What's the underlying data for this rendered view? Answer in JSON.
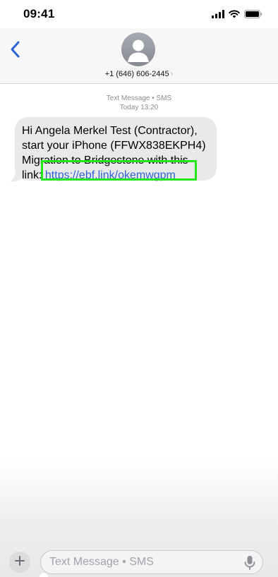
{
  "status_bar": {
    "time": "09:41"
  },
  "header": {
    "contact": "+1 (646) 606-2445",
    "chevron": "›"
  },
  "conversation": {
    "service": "Text Message • SMS",
    "timestamp": "Today 13:20"
  },
  "message": {
    "lines": [
      "Hi Angela Merkel Test (Contractor),",
      "start your iPhone (FFWX838EKPH4)",
      "Migration to Bridgestone with this"
    ],
    "link_prefix": "link:",
    "link_text": "https://ebf.link/okemwgpm"
  },
  "compose": {
    "placeholder": "Text Message • SMS"
  },
  "colors": {
    "accent": "#2e63d6",
    "bubble": "#e9e9eb",
    "highlight": "#22e61a"
  },
  "icons": {
    "back": "chevron-left-icon",
    "avatar": "person-icon",
    "signal": "signal-bars-icon",
    "wifi": "wifi-icon",
    "battery": "battery-icon",
    "plus": "plus-icon",
    "mic": "microphone-icon"
  }
}
